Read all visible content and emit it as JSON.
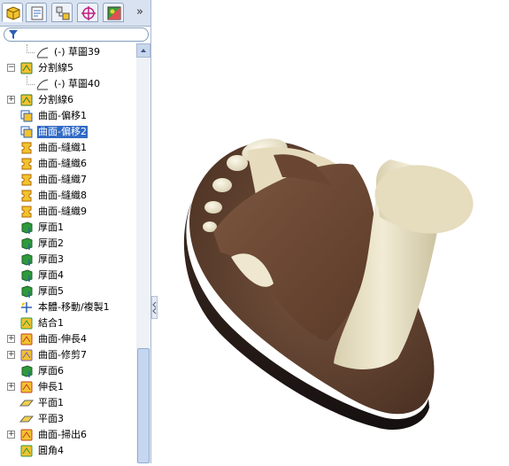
{
  "feature_tree": {
    "items": [
      {
        "label": "(-) 草圖39",
        "icon": "sketch-icon",
        "level": 2,
        "expander": "",
        "selected": false
      },
      {
        "label": "分割線5",
        "icon": "split-line-icon",
        "level": 1,
        "expander": "-",
        "selected": false
      },
      {
        "label": "(-) 草圖40",
        "icon": "sketch-icon",
        "level": 2,
        "expander": "",
        "selected": false
      },
      {
        "label": "分割線6",
        "icon": "split-line-icon",
        "level": 1,
        "expander": "+",
        "selected": false
      },
      {
        "label": "曲面-偏移1",
        "icon": "offset-surface-icon",
        "level": 1,
        "expander": "",
        "selected": false
      },
      {
        "label": "曲面-偏移2",
        "icon": "offset-surface-icon",
        "level": 1,
        "expander": "",
        "selected": true
      },
      {
        "label": "曲面-縫織1",
        "icon": "knit-surface-icon",
        "level": 1,
        "expander": "",
        "selected": false
      },
      {
        "label": "曲面-縫織6",
        "icon": "knit-surface-icon",
        "level": 1,
        "expander": "",
        "selected": false
      },
      {
        "label": "曲面-縫織7",
        "icon": "knit-surface-icon",
        "level": 1,
        "expander": "",
        "selected": false
      },
      {
        "label": "曲面-縫織8",
        "icon": "knit-surface-icon",
        "level": 1,
        "expander": "",
        "selected": false
      },
      {
        "label": "曲面-縫織9",
        "icon": "knit-surface-icon",
        "level": 1,
        "expander": "",
        "selected": false
      },
      {
        "label": "厚面1",
        "icon": "thicken-icon",
        "level": 1,
        "expander": "",
        "selected": false
      },
      {
        "label": "厚面2",
        "icon": "thicken-icon",
        "level": 1,
        "expander": "",
        "selected": false
      },
      {
        "label": "厚面3",
        "icon": "thicken-icon",
        "level": 1,
        "expander": "",
        "selected": false
      },
      {
        "label": "厚面4",
        "icon": "thicken-icon",
        "level": 1,
        "expander": "",
        "selected": false
      },
      {
        "label": "厚面5",
        "icon": "thicken-icon",
        "level": 1,
        "expander": "",
        "selected": false
      },
      {
        "label": "本體-移動/複製1",
        "icon": "move-body-icon",
        "level": 1,
        "expander": "",
        "selected": false
      },
      {
        "label": "結合1",
        "icon": "combine-icon",
        "level": 1,
        "expander": "",
        "selected": false
      },
      {
        "label": "曲面-伸長4",
        "icon": "extrude-surface-icon",
        "level": 1,
        "expander": "+",
        "selected": false
      },
      {
        "label": "曲面-修剪7",
        "icon": "trim-surface-icon",
        "level": 1,
        "expander": "+",
        "selected": false
      },
      {
        "label": "厚面6",
        "icon": "thicken-icon",
        "level": 1,
        "expander": "",
        "selected": false
      },
      {
        "label": "伸長1",
        "icon": "extrude-icon",
        "level": 1,
        "expander": "+",
        "selected": false
      },
      {
        "label": "平面1",
        "icon": "plane-icon",
        "level": 1,
        "expander": "",
        "selected": false
      },
      {
        "label": "平面3",
        "icon": "plane-icon",
        "level": 1,
        "expander": "",
        "selected": false
      },
      {
        "label": "曲面-掃出6",
        "icon": "sweep-surface-icon",
        "level": 1,
        "expander": "+",
        "selected": false
      },
      {
        "label": "圓角4",
        "icon": "fillet-icon",
        "level": 1,
        "expander": "",
        "selected": false
      }
    ]
  },
  "tabs": [
    {
      "name": "feature-manager-tab",
      "active": true
    },
    {
      "name": "property-manager-tab",
      "active": false
    },
    {
      "name": "configuration-manager-tab",
      "active": false
    },
    {
      "name": "dimxpert-manager-tab",
      "active": false
    },
    {
      "name": "display-manager-tab",
      "active": false
    }
  ],
  "tab_overflow_label": "»",
  "colors": {
    "selection": "#316ac5",
    "sole": "#5a3a26",
    "strap": "#6e4a35",
    "foot": "#e8e0c4",
    "panel_tab_bg": "#d8e2f0"
  },
  "viewport": {
    "model": "sandal-with-foot",
    "description_icon": "3d-model-view"
  }
}
